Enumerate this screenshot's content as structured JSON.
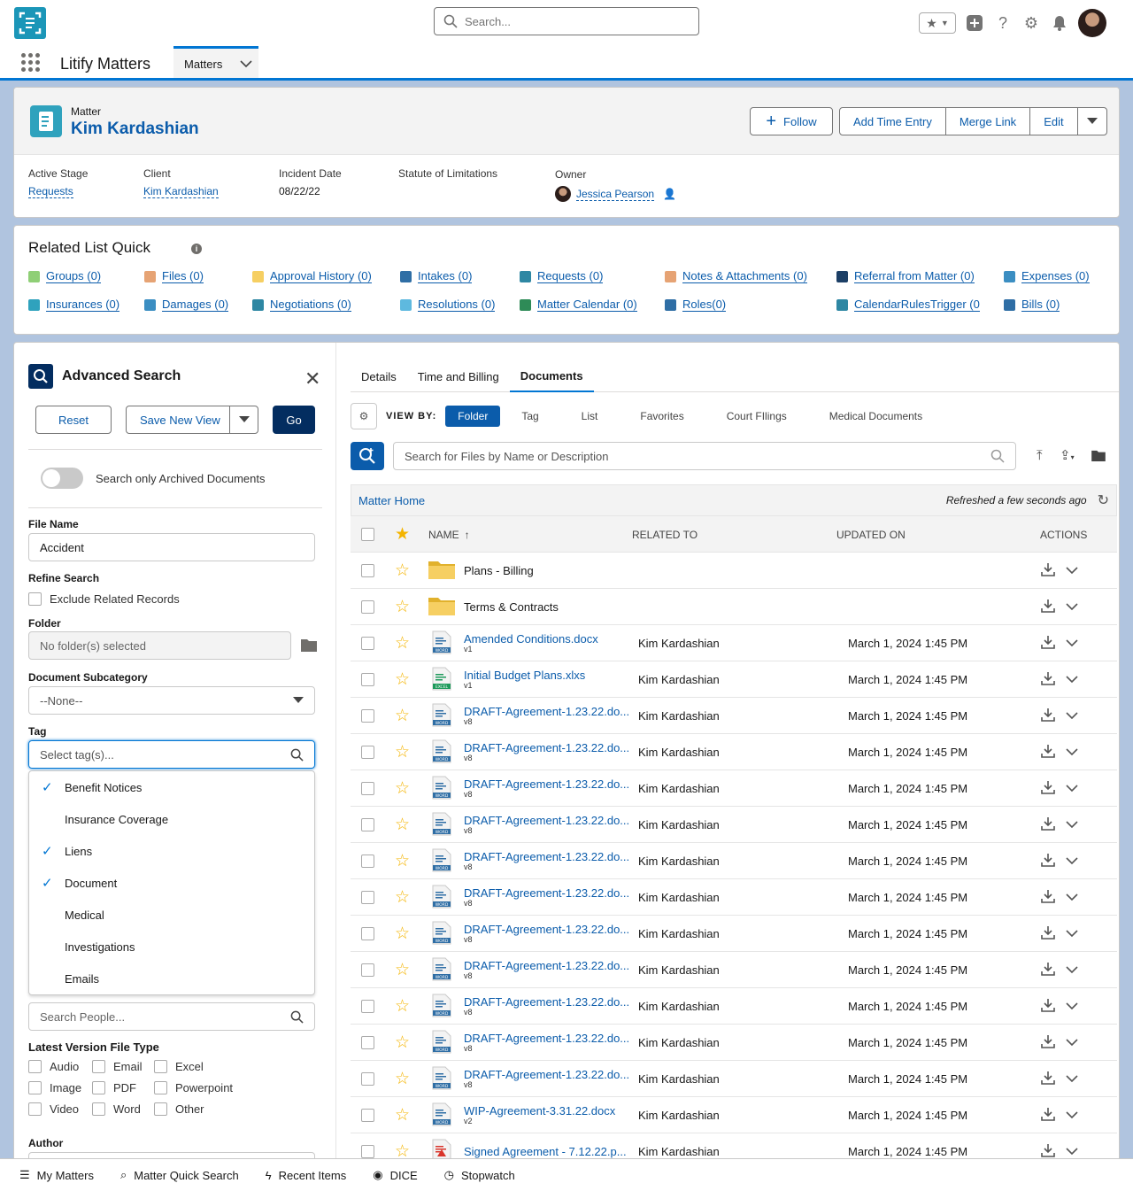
{
  "header": {
    "search_placeholder": "Search...",
    "app_name": "Litify Matters",
    "nav_tab": "Matters"
  },
  "record": {
    "object_label": "Matter",
    "name": "Kim Kardashian",
    "actions": {
      "follow": "Follow",
      "add_time": "Add Time Entry",
      "merge": "Merge Link",
      "edit": "Edit"
    },
    "fields": [
      {
        "label": "Active Stage",
        "value": "Requests"
      },
      {
        "label": "Client",
        "value": "Kim Kardashian"
      },
      {
        "label": "Incident Date",
        "value": "08/22/22"
      },
      {
        "label": "Statute of Limitations",
        "value": ""
      },
      {
        "label": "Owner",
        "value": "Jessica Pearson"
      }
    ]
  },
  "related": {
    "title": "Related List Quick",
    "info": "i",
    "items": [
      {
        "label": "Groups (0)",
        "color": "#8fcf76"
      },
      {
        "label": "Files (0)",
        "color": "#e6a374"
      },
      {
        "label": "Approval History (0)",
        "color": "#f6cf62"
      },
      {
        "label": "Intakes (0)",
        "color": "#2f6ea5"
      },
      {
        "label": "Requests (0)",
        "color": "#2e87a3"
      },
      {
        "label": "Notes & Attachments (0)",
        "color": "#e6a374"
      },
      {
        "label": "Referral from Matter (0)",
        "color": "#1c3f66"
      },
      {
        "label": "Expenses (0)",
        "color": "#3b8ec2"
      },
      {
        "label": "Insurances (0)",
        "color": "#2fa2bd"
      },
      {
        "label": "Damages (0)",
        "color": "#3b8ec2"
      },
      {
        "label": "Negotiations (0)",
        "color": "#2e87a3"
      },
      {
        "label": "Resolutions (0)",
        "color": "#5eb9df"
      },
      {
        "label": "Matter Calendar (0)",
        "color": "#2e8b57"
      },
      {
        "label": "Roles(0)",
        "color": "#2f6ea5"
      },
      {
        "label": "CalendarRulesTrigger (0",
        "color": "#2e87a3"
      },
      {
        "label": "Bills (0)",
        "color": "#2f6ea5"
      }
    ]
  },
  "advanced": {
    "title": "Advanced Search",
    "reset": "Reset",
    "save_view": "Save New View",
    "go": "Go",
    "archived_toggle": "Search only Archived Documents",
    "file_name_label": "File Name",
    "file_name_value": "Accident",
    "refine_label": "Refine Search",
    "exclude_related": "Exclude Related Records",
    "folder_label": "Folder",
    "folder_placeholder": "No folder(s) selected",
    "subcat_label": "Document Subcategory",
    "subcat_value": "--None--",
    "tag_label": "Tag",
    "tag_placeholder": "Select tag(s)...",
    "tag_options": [
      {
        "label": "Benefit Notices",
        "checked": true
      },
      {
        "label": "Insurance Coverage",
        "checked": false
      },
      {
        "label": "Liens",
        "checked": true
      },
      {
        "label": "Document",
        "checked": true
      },
      {
        "label": "Medical",
        "checked": false
      },
      {
        "label": "Investigations",
        "checked": false
      },
      {
        "label": "Emails",
        "checked": false
      }
    ],
    "people_placeholder": "Search People...",
    "filetype_label": "Latest Version File Type",
    "filetypes": [
      "Audio",
      "Email",
      "Excel",
      "Image",
      "PDF",
      "Powerpoint",
      "Video",
      "Word",
      "Other"
    ],
    "author_label": "Author"
  },
  "docs": {
    "tabs": [
      "Details",
      "Time and Billing",
      "Documents"
    ],
    "active_tab": "Documents",
    "view_by": "VIEW BY:",
    "view_options": [
      "Folder",
      "Tag",
      "List",
      "Favorites",
      "Court FIlings",
      "Medical Documents"
    ],
    "active_view": "Folder",
    "search_placeholder": "Search for Files by Name or Description",
    "breadcrumb": "Matter Home",
    "refreshed": "Refreshed a few seconds ago",
    "columns": {
      "name": "NAME",
      "related": "RELATED TO",
      "updated": "UPDATED ON",
      "actions": "ACTIONS"
    },
    "rows": [
      {
        "type": "folder",
        "name": "Plans - Billing",
        "ver": "",
        "related": "",
        "updated": ""
      },
      {
        "type": "folder",
        "name": "Terms & Contracts",
        "ver": "",
        "related": "",
        "updated": ""
      },
      {
        "type": "word",
        "name": "Amended Conditions.docx",
        "ver": "v1",
        "related": "Kim Kardashian",
        "updated": "March 1, 2024 1:45 PM"
      },
      {
        "type": "excel",
        "name": "Initial Budget Plans.xlxs",
        "ver": "v1",
        "related": "Kim Kardashian",
        "updated": "March 1, 2024 1:45 PM"
      },
      {
        "type": "word",
        "name": "DRAFT-Agreement-1.23.22.do...",
        "ver": "v8",
        "related": "Kim Kardashian",
        "updated": "March 1, 2024 1:45 PM"
      },
      {
        "type": "word",
        "name": "DRAFT-Agreement-1.23.22.do...",
        "ver": "v8",
        "related": "Kim Kardashian",
        "updated": "March 1, 2024 1:45 PM"
      },
      {
        "type": "word",
        "name": "DRAFT-Agreement-1.23.22.do...",
        "ver": "v8",
        "related": "Kim Kardashian",
        "updated": "March 1, 2024 1:45 PM"
      },
      {
        "type": "word",
        "name": "DRAFT-Agreement-1.23.22.do...",
        "ver": "v8",
        "related": "Kim Kardashian",
        "updated": "March 1, 2024 1:45 PM"
      },
      {
        "type": "word",
        "name": "DRAFT-Agreement-1.23.22.do...",
        "ver": "v8",
        "related": "Kim Kardashian",
        "updated": "March 1, 2024 1:45 PM"
      },
      {
        "type": "word",
        "name": "DRAFT-Agreement-1.23.22.do...",
        "ver": "v8",
        "related": "Kim Kardashian",
        "updated": "March 1, 2024 1:45 PM"
      },
      {
        "type": "word",
        "name": "DRAFT-Agreement-1.23.22.do...",
        "ver": "v8",
        "related": "Kim Kardashian",
        "updated": "March 1, 2024 1:45 PM"
      },
      {
        "type": "word",
        "name": "DRAFT-Agreement-1.23.22.do...",
        "ver": "v8",
        "related": "Kim Kardashian",
        "updated": "March 1, 2024 1:45 PM"
      },
      {
        "type": "word",
        "name": "DRAFT-Agreement-1.23.22.do...",
        "ver": "v8",
        "related": "Kim Kardashian",
        "updated": "March 1, 2024 1:45 PM"
      },
      {
        "type": "word",
        "name": "DRAFT-Agreement-1.23.22.do...",
        "ver": "v8",
        "related": "Kim Kardashian",
        "updated": "March 1, 2024 1:45 PM"
      },
      {
        "type": "word",
        "name": "DRAFT-Agreement-1.23.22.do...",
        "ver": "v8",
        "related": "Kim Kardashian",
        "updated": "March 1, 2024 1:45 PM"
      },
      {
        "type": "word",
        "name": "WIP-Agreement-3.31.22.docx",
        "ver": "v2",
        "related": "Kim Kardashian",
        "updated": "March 1, 2024 1:45 PM"
      },
      {
        "type": "pdf",
        "name": "Signed Agreement - 7.12.22.p...",
        "ver": "",
        "related": "Kim Kardashian",
        "updated": "March 1, 2024 1:45 PM"
      }
    ]
  },
  "footer": [
    "My Matters",
    "Matter Quick Search",
    "Recent Items",
    "DICE",
    "Stopwatch"
  ]
}
